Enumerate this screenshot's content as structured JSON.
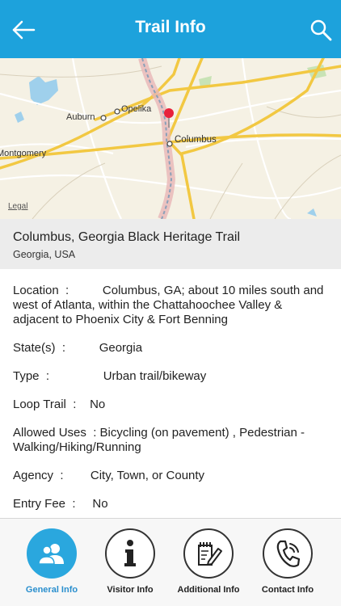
{
  "header": {
    "title": "Trail Info",
    "back_icon": "back-arrow-icon",
    "search_icon": "search-icon"
  },
  "map": {
    "labels": {
      "auburn": "Auburn",
      "opelika": "Opelika",
      "columbus": "Columbus",
      "montgomery": "Montgomery"
    },
    "legal": "Legal",
    "pin_color": "#e8213b"
  },
  "trail": {
    "name": "Columbus, Georgia Black Heritage Trail",
    "region": "Georgia, USA"
  },
  "info": {
    "location_label": "Location",
    "location_value": "Columbus, GA; about 10 miles south and west of Atlanta, within the Chattahoochee Valley & adjacent to Phoenix City & Fort Benning",
    "state_label": "State(s)",
    "state_value": "Georgia",
    "type_label": "Type",
    "type_value": "Urban trail/bikeway",
    "loop_label": "Loop Trail",
    "loop_value": "No",
    "uses_label": "Allowed Uses",
    "uses_value": "Bicycling (on pavement) , Pedestrian - Walking/Hiking/Running",
    "agency_label": "Agency",
    "agency_value": "City, Town, or County",
    "fee_label": "Entry Fee",
    "fee_value": "No"
  },
  "nav": {
    "items": [
      {
        "label": "General Info",
        "icon": "users-icon",
        "active": true
      },
      {
        "label": "Visitor Info",
        "icon": "info-icon",
        "active": false
      },
      {
        "label": "Additional Info",
        "icon": "edit-document-icon",
        "active": false
      },
      {
        "label": "Contact Info",
        "icon": "phone-icon",
        "active": false
      }
    ]
  },
  "colors": {
    "header_bg": "#1da2dc",
    "active_nav": "#2aa7de"
  }
}
